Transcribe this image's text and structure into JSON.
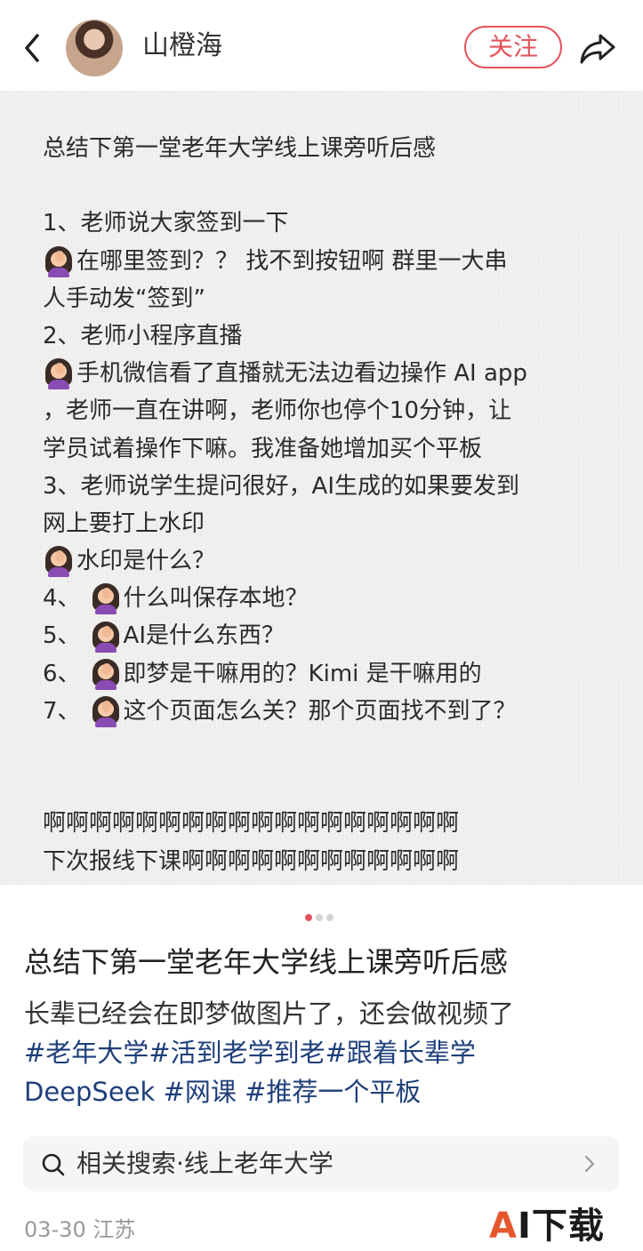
{
  "header": {
    "author_name": "山橙海",
    "follow_label": "关注"
  },
  "slide": {
    "lines": [
      {
        "emoji": false,
        "text": "总结下第一堂老年大学线上课旁听后感"
      },
      {
        "emoji": false,
        "text": ""
      },
      {
        "emoji": false,
        "text": "1、老师说大家签到一下"
      },
      {
        "emoji": true,
        "prefix": "",
        "text": "在哪里签到？？ 找不到按钮啊  群里一大串"
      },
      {
        "emoji": false,
        "text": "人手动发“签到”"
      },
      {
        "emoji": false,
        "text": "2、老师小程序直播"
      },
      {
        "emoji": true,
        "prefix": "",
        "text": "手机微信看了直播就无法边看边操作 AI app"
      },
      {
        "emoji": false,
        "text": "，老师一直在讲啊，老师你也停个10分钟，让"
      },
      {
        "emoji": false,
        "text": "学员试着操作下嘛。我准备她增加买个平板"
      },
      {
        "emoji": false,
        "text": "3、老师说学生提问很好，AI生成的如果要发到"
      },
      {
        "emoji": false,
        "text": "网上要打上水印"
      },
      {
        "emoji": true,
        "prefix": "",
        "text": "水印是什么？"
      },
      {
        "emoji": true,
        "prefix": "4、",
        "text": "什么叫保存本地？"
      },
      {
        "emoji": true,
        "prefix": "5、",
        "text": "AI是什么东西？"
      },
      {
        "emoji": true,
        "prefix": "6、",
        "text": "即梦是干嘛用的？Kimi 是干嘛用的"
      },
      {
        "emoji": true,
        "prefix": "7、",
        "text": "这个页面怎么关？那个页面找不到了？"
      },
      {
        "emoji": false,
        "text": ""
      },
      {
        "emoji": false,
        "text": ""
      },
      {
        "emoji": false,
        "text": "啊啊啊啊啊啊啊啊啊啊啊啊啊啊啊啊啊啊"
      },
      {
        "emoji": false,
        "text": "下次报线下课啊啊啊啊啊啊啊啊啊啊啊啊"
      }
    ]
  },
  "pagination": {
    "total": 3,
    "active": 0
  },
  "post": {
    "title": "总结下第一堂老年大学线上课旁听后感",
    "body_text": "长辈已经会在即梦做图片了，还会做视频了",
    "tags_line1": "#老年大学#活到老学到老#跟着长辈学",
    "tags_line2": "DeepSeek #网课 #推荐一个平板"
  },
  "related_search": {
    "label": "相关搜索·线上老年大学"
  },
  "meta": {
    "date_location": "03-30 江苏"
  },
  "watermark": {
    "a": "A",
    "rest": "I下载"
  },
  "colors": {
    "accent": "#e3545c",
    "tag": "#1f3f7a"
  }
}
